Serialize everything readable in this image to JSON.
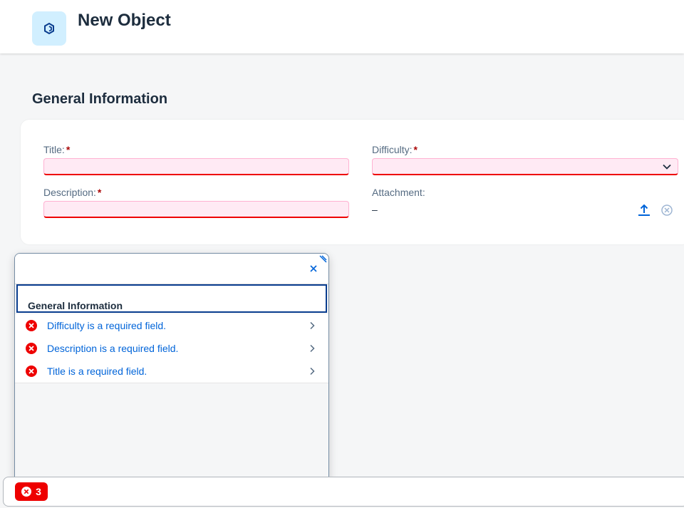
{
  "header": {
    "title": "New Object",
    "app_icon": "object-icon"
  },
  "section": {
    "title": "General Information"
  },
  "form": {
    "title_label": "Title:",
    "difficulty_label": "Difficulty:",
    "description_label": "Description:",
    "attachment_label": "Attachment:",
    "attachment_value": "–",
    "required_mark": "*"
  },
  "messages": {
    "group_title": "General Information",
    "items": [
      {
        "text": "Difficulty is a required field.",
        "type": "error"
      },
      {
        "text": "Description is a required field.",
        "type": "error"
      },
      {
        "text": "Title is a required field.",
        "type": "error"
      }
    ]
  },
  "footer": {
    "error_count": "3"
  },
  "colors": {
    "error": "#ee0000",
    "link": "#0064d9",
    "header_icon_bg": "#d1efff"
  }
}
